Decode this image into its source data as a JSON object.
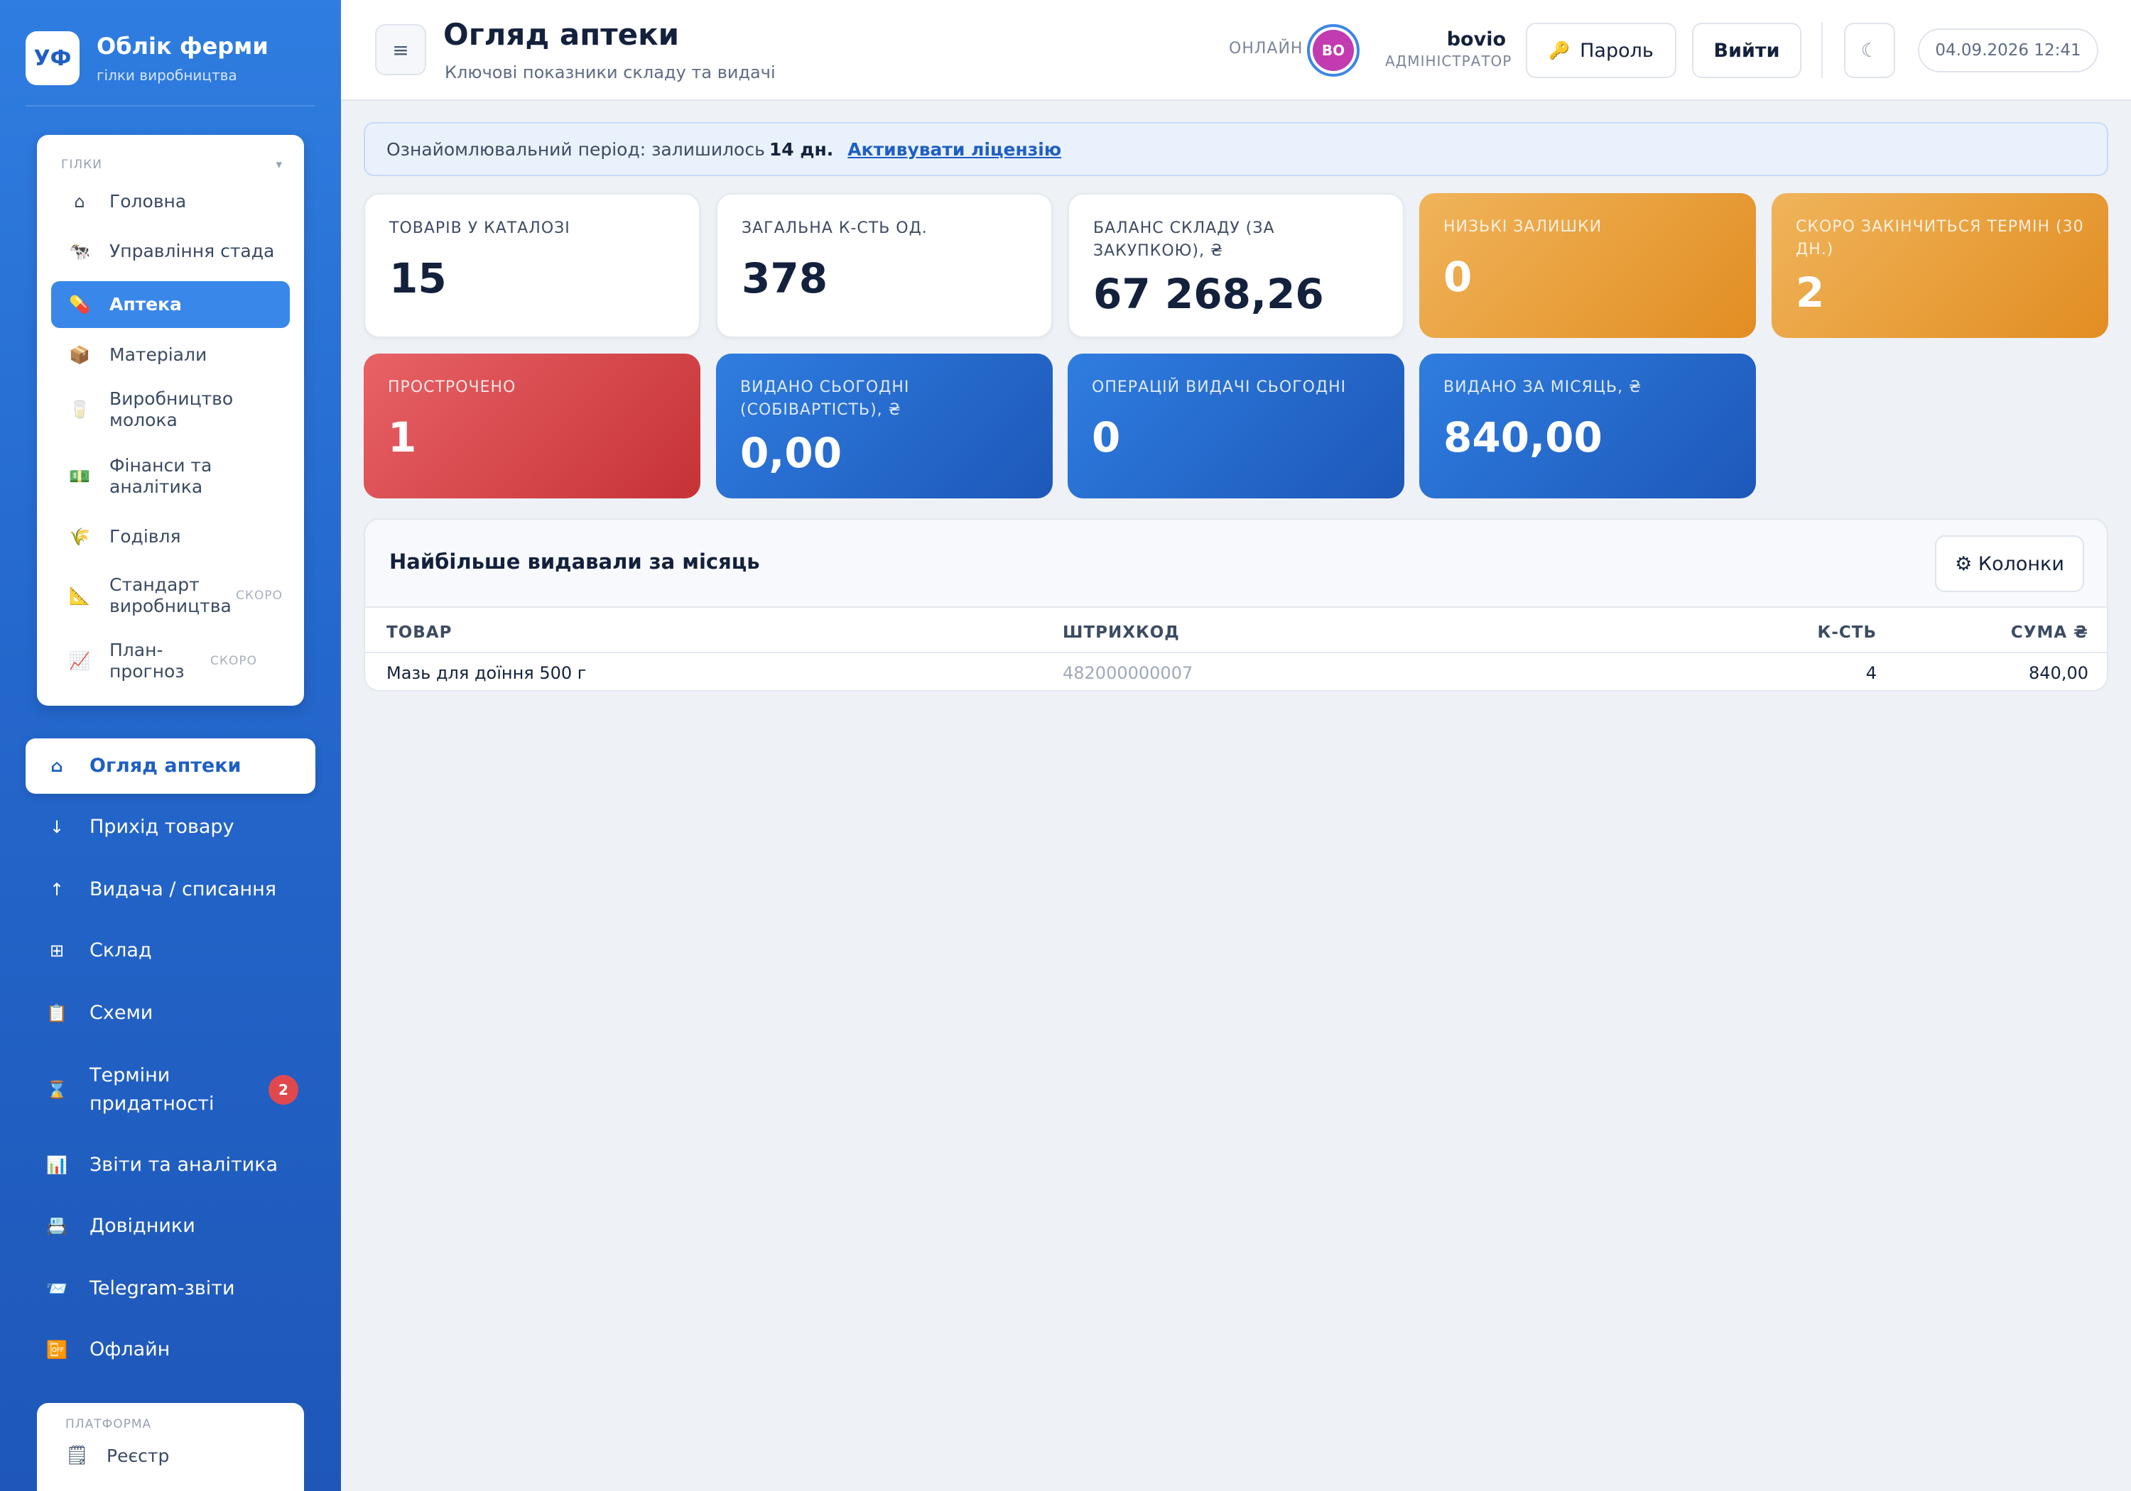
{
  "brand": {
    "logo": "УФ",
    "title": "Облік ферми",
    "subtitle": "гілки виробництва"
  },
  "branches": {
    "header": "ГІЛКИ",
    "toggle_icon": "▾",
    "items": [
      {
        "icon": "⌂",
        "icon_name": "home-icon",
        "label": "Головна"
      },
      {
        "icon": "🐄",
        "icon_name": "cow-icon",
        "label": "Управління стада"
      },
      {
        "icon": "💊",
        "icon_name": "pill-icon",
        "label": "Аптека"
      },
      {
        "icon": "📦",
        "icon_name": "box-icon",
        "label": "Матеріали"
      },
      {
        "icon": "🥛",
        "icon_name": "milk-icon",
        "label": "Виробництво молока"
      },
      {
        "icon": "💵",
        "icon_name": "money-icon",
        "label": "Фінанси та аналітика"
      },
      {
        "icon": "🌾",
        "icon_name": "feed-icon",
        "label": "Годівля"
      },
      {
        "icon": "📐",
        "icon_name": "ruler-icon",
        "label": "Стандарт виробництва",
        "badge": "СКОРО"
      },
      {
        "icon": "📈",
        "icon_name": "chart-up-icon",
        "label": "План-прогноз",
        "badge": "СКОРО"
      }
    ]
  },
  "nav": {
    "items": [
      {
        "icon": "⌂",
        "icon_name": "home-icon",
        "label": "Огляд аптеки"
      },
      {
        "icon": "↓",
        "icon_name": "arrow-down-icon",
        "label": "Прихід товару"
      },
      {
        "icon": "↑",
        "icon_name": "arrow-up-icon",
        "label": "Видача / списання"
      },
      {
        "icon": "⊞",
        "icon_name": "grid-icon",
        "label": "Склад"
      },
      {
        "icon": "📋",
        "icon_name": "clipboard-icon",
        "label": "Схеми"
      },
      {
        "icon": "⌛",
        "icon_name": "hourglass-icon",
        "label": "Терміни придатності",
        "badge": "2"
      },
      {
        "icon": "📊",
        "icon_name": "bar-chart-icon",
        "label": "Звіти та аналітика"
      },
      {
        "icon": "📇",
        "icon_name": "cardfile-icon",
        "label": "Довідники"
      },
      {
        "icon": "📨",
        "icon_name": "telegram-icon",
        "label": "Telegram-звіти"
      },
      {
        "icon": "📴",
        "icon_name": "offline-icon",
        "label": "Офлайн"
      }
    ]
  },
  "platform": {
    "header": "ПЛАТФОРМА",
    "item": {
      "icon": "🗒",
      "icon_name": "registry-icon",
      "label": "Реєстр"
    }
  },
  "header": {
    "menu_icon": "≡",
    "title": "Огляд аптеки",
    "subtitle": "Ключові показники складу та видачі",
    "online": "ОНЛАЙН",
    "avatar": "BO",
    "user": "bovio",
    "role": "АДМІНІСТРАТОР",
    "password_icon": "🔑",
    "password_label": "Пароль",
    "logout_label": "Вийти",
    "theme_icon": "☾",
    "datetime": "04.09.2026 12:41"
  },
  "trial": {
    "text": "Ознайомлювальний період: залишилось",
    "days": "14 дн.",
    "link": "Активувати ліцензію"
  },
  "stats": [
    {
      "label": "ТОВАРІВ У КАТАЛОЗІ",
      "value": "15",
      "variant": "white"
    },
    {
      "label": "ЗАГАЛЬНА К-СТЬ ОД.",
      "value": "378",
      "variant": "white"
    },
    {
      "label": "БАЛАНС СКЛАДУ (ЗА ЗАКУПКОЮ), ₴",
      "value": "67 268,26",
      "variant": "white"
    },
    {
      "label": "НИЗЬКІ ЗАЛИШКИ",
      "value": "0",
      "variant": "orange"
    },
    {
      "label": "СКОРО ЗАКІНЧИТЬСЯ ТЕРМІН (30 ДН.)",
      "value": "2",
      "variant": "orange"
    },
    {
      "label": "ПРОСТРОЧЕНО",
      "value": "1",
      "variant": "red"
    },
    {
      "label": "ВИДАНО СЬОГОДНІ (СОБІВАРТІСТЬ), ₴",
      "value": "0,00",
      "variant": "blue"
    },
    {
      "label": "ОПЕРАЦІЙ ВИДАЧІ СЬОГОДНІ",
      "value": "0",
      "variant": "blue"
    },
    {
      "label": "ВИДАНО ЗА МІСЯЦЬ, ₴",
      "value": "840,00",
      "variant": "blue"
    }
  ],
  "top_issued": {
    "title": "Найбільше видавали за місяць",
    "columns_button": "⚙ Колонки",
    "headers": {
      "product": "ТОВАР",
      "barcode": "ШТРИХКОД",
      "qty": "К-СТЬ",
      "sum": "СУМА ₴"
    },
    "rows": [
      {
        "product": "Мазь для доїння 500 г",
        "barcode": "482000000007",
        "qty": "4",
        "sum": "840,00"
      }
    ]
  },
  "colors": {
    "sidebar": "#2467cc",
    "accent": "#3a87ea",
    "orange": "#e9a13e",
    "red": "#d9474b",
    "blue": "#2367c8"
  }
}
